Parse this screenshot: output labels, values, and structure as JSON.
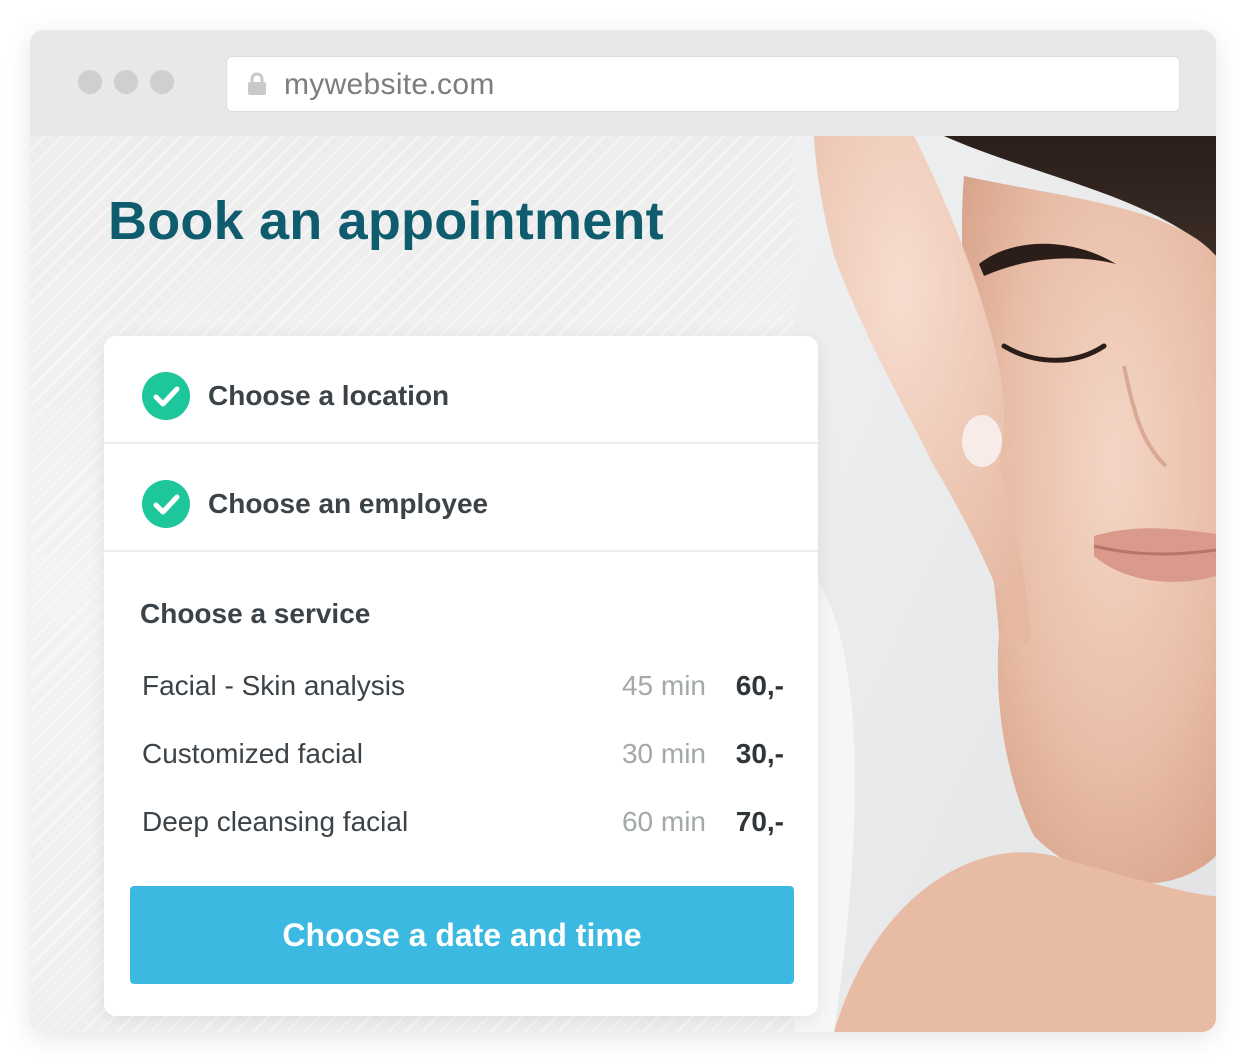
{
  "browser": {
    "url": "mywebsite.com",
    "window_dots": [
      "close",
      "minimize",
      "maximize"
    ],
    "lock_icon": "lock-icon"
  },
  "page": {
    "title": "Book an appointment"
  },
  "booking": {
    "steps": [
      {
        "label": "Choose a location",
        "completed": true,
        "icon": "check-circle-icon"
      },
      {
        "label": "Choose an employee",
        "completed": true,
        "icon": "check-circle-icon"
      }
    ],
    "service_section": {
      "heading": "Choose a service",
      "services": [
        {
          "name": "Facial - Skin analysis",
          "duration": "45 min",
          "price": "60,-"
        },
        {
          "name": "Customized facial",
          "duration": "30 min",
          "price": "30,-"
        },
        {
          "name": "Deep cleansing facial",
          "duration": "60 min",
          "price": "70,-"
        }
      ]
    },
    "cta_label": "Choose a date and time"
  },
  "colors": {
    "title": "#0f5c6e",
    "check": "#1ec79b",
    "cta": "#3bb9e0",
    "text": "#3c4348",
    "muted": "#a3a8ab"
  }
}
